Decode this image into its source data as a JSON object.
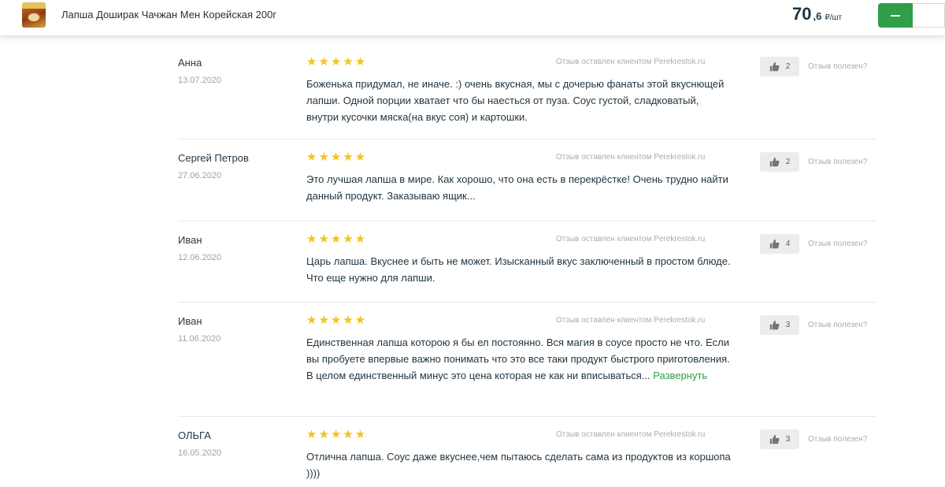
{
  "header": {
    "product_title": "Лапша Доширак Чачжан Мен Корейская 200г",
    "price_int": "70",
    "price_frac": ",6",
    "price_unit": "₽/шт",
    "minus_icon": "minus-icon",
    "accent_color": "#2f9e47"
  },
  "reviews": [
    {
      "author": "Анна",
      "date": "13.07.2020",
      "stars": "★★★★★",
      "rating": 5,
      "source": "Отзыв оставлен клиентом Perekrestok.ru",
      "text": "Боженька придумал, не иначе. :) очень вкусная, мы с дочерью фанаты этой вкуснющей лапши. Одной порции хватает что бы наесться от пуза. Соус густой, сладковатый, внутри кусочки мяска(на вкус соя) и картошки.",
      "likes": "2",
      "helpful": "Отзыв полезен?"
    },
    {
      "author": "Сергей Петров",
      "date": "27.06.2020",
      "stars": "★★★★★",
      "rating": 5,
      "source": "Отзыв оставлен клиентом Perekrestok.ru",
      "text": "Это лучшая лапша в мире. Как хорошо, что она есть в перекрёстке! Очень трудно найти данный продукт. Заказываю ящик...",
      "likes": "2",
      "helpful": "Отзыв полезен?"
    },
    {
      "author": "Иван",
      "date": "12.06.2020",
      "stars": "★★★★★",
      "rating": 5,
      "source": "Отзыв оставлен клиентом Perekrestok.ru",
      "text": "Царь лапша. Вкуснее и быть не может. Изысканный вкус заключенный в простом блюде. Что еще нужно для лапши.",
      "likes": "4",
      "helpful": "Отзыв полезен?"
    },
    {
      "author": "Иван",
      "date": "11.06.2020",
      "stars": "★★★★★",
      "rating": 5,
      "source": "Отзыв оставлен клиентом Perekrestok.ru",
      "text": "Единственная лапша которою я бы ел постоянно. Вся магия в соусе просто не что. Если вы пробуете впервые важно понимать что это все таки продукт быстрого приготовления. В целом единственный минус это цена которая не как ни вписываться...",
      "expand": "Развернуть",
      "likes": "3",
      "helpful": "Отзыв полезен?"
    },
    {
      "author": "ОЛЬГА",
      "date": "16.05.2020",
      "stars": "★★★★★",
      "rating": 5,
      "source": "Отзыв оставлен клиентом Perekrestok.ru",
      "text": "Отлична лапша. Соус даже вкуснее,чем пытаюсь сделать сама из продуктов из коршопа ))))",
      "likes": "3",
      "helpful": "Отзыв полезен?"
    }
  ]
}
